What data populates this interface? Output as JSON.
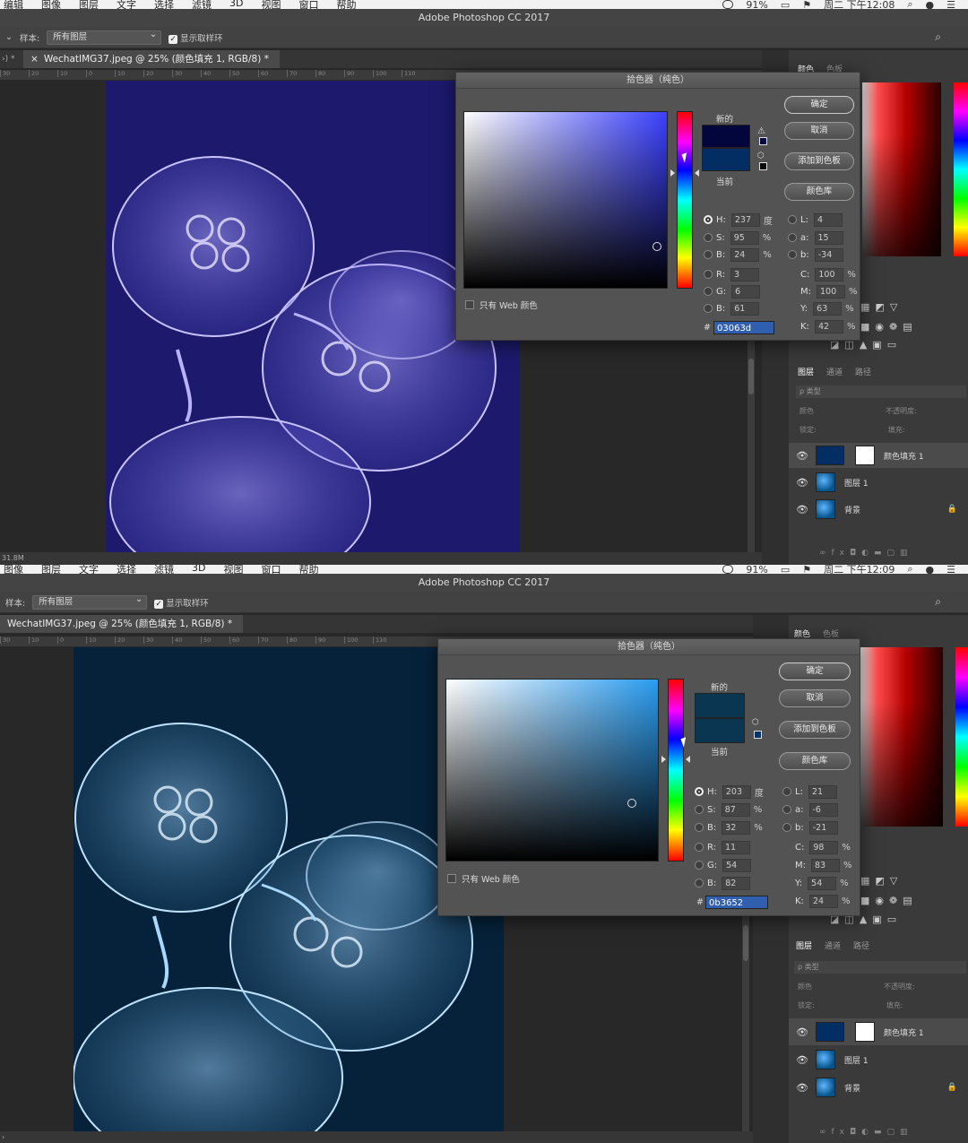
{
  "menubar": {
    "top_items": [
      "编辑",
      "图像",
      "图层",
      "文字",
      "选择",
      "滤镜",
      "3D",
      "视图",
      "窗口",
      "帮助"
    ],
    "bottom_items": [
      "图像",
      "图层",
      "文字",
      "选择",
      "滤镜",
      "3D",
      "视图",
      "窗口",
      "帮助"
    ],
    "battery": "91%",
    "time_top": "周二 下午12:08",
    "time_bottom": "周二 下午12:09"
  },
  "app_title": "Adobe Photoshop CC 2017",
  "options": {
    "sample_label": "样本:",
    "sample_value": "所有图层",
    "show_ring": "显示取样环"
  },
  "document_tab": "WechatIMG37.jpeg @ 25% (颜色填充 1, RGB/8) *",
  "status_size": "31.8M",
  "ruler_ticks": [
    "30",
    "20",
    "10",
    "0",
    "10",
    "20",
    "30",
    "40",
    "50",
    "60",
    "70",
    "80",
    "90",
    "100",
    "110"
  ],
  "panels": {
    "color_tabs": [
      "颜色",
      "色板"
    ],
    "layer_tabs": [
      "图层",
      "通道",
      "路径"
    ],
    "search_kind": "ρ 类型",
    "blend_mode": "颜色",
    "opacity_label": "不透明度:",
    "lock_label": "锁定:",
    "fill_label": "填充:",
    "layers": [
      "颜色填充 1",
      "图层 1",
      "背景"
    ]
  },
  "picker": {
    "title": "拾色器（纯色）",
    "new_label": "新的",
    "current_label": "当前",
    "ok": "确定",
    "cancel": "取消",
    "add_swatch": "添加到色板",
    "color_library": "颜色库",
    "web_only": "只有 Web 颜色",
    "degree_unit": "度",
    "percent_unit": "%",
    "labels": {
      "H": "H:",
      "S": "S:",
      "B": "B:",
      "R": "R:",
      "G": "G:",
      "Bb": "B:",
      "L": "L:",
      "a": "a:",
      "b": "b:",
      "C": "C:",
      "M": "M:",
      "Y": "Y:",
      "K": "K:"
    }
  },
  "pickers": [
    {
      "H": "237",
      "S": "95",
      "B": "24",
      "R": "3",
      "G": "6",
      "Bb": "61",
      "L": "4",
      "a": "15",
      "b": "-34",
      "C": "100",
      "M": "100",
      "Y": "63",
      "K": "42",
      "hex": "03063d",
      "new_color": "#03063d",
      "current_color": "#032e63"
    },
    {
      "H": "203",
      "S": "87",
      "B": "32",
      "R": "11",
      "G": "54",
      "Bb": "82",
      "L": "21",
      "a": "-6",
      "b": "-21",
      "C": "98",
      "M": "83",
      "Y": "54",
      "K": "24",
      "hex": "0b3652",
      "new_color": "#0b3652",
      "current_color": "#0b3652"
    }
  ],
  "colors": {
    "photo_top_bg": "#1d1a6e",
    "photo_bottom_bg": "#06223a",
    "jelly_top": "#c9c3ff",
    "jelly_bottom": "#bfe3ff",
    "hue_top": "#3a40ff",
    "hue_bottom": "#2a9cf0"
  }
}
